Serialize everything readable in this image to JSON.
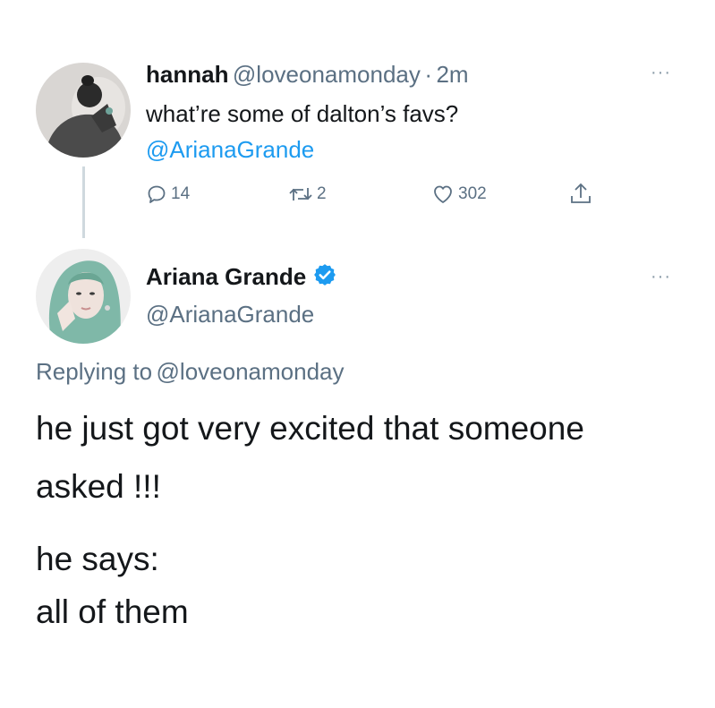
{
  "tweet1": {
    "display_name": "hannah",
    "handle": "@loveonamonday",
    "separator": "·",
    "time": "2m",
    "text": "what’re some of dalton’s favs?",
    "mention": "@ArianaGrande",
    "more": "···",
    "actions": {
      "reply_count": "14",
      "retweet_count": "2",
      "like_count": "302"
    },
    "icons": [
      "reply-icon",
      "retweet-icon",
      "like-icon",
      "share-icon"
    ]
  },
  "tweet2": {
    "display_name": "Ariana Grande",
    "handle": "@ArianaGrande",
    "verified": true,
    "more": "···",
    "replying_prefix": "Replying to",
    "replying_handle": "@loveonamonday",
    "line1": "he just got very excited that someone",
    "line2": "asked !!!",
    "line3": "he says:",
    "line4": "all of them"
  },
  "colors": {
    "accent": "#1d9bf0",
    "secondary_text": "#5b7083",
    "primary_text": "#14171a"
  }
}
